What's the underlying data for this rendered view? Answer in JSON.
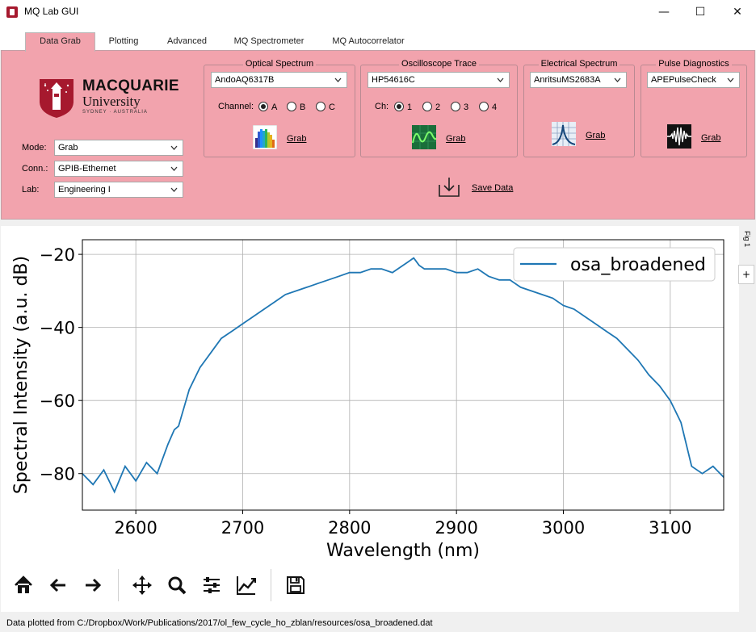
{
  "window": {
    "title": "MQ Lab GUI",
    "min": "—",
    "max": "☐",
    "close": "✕"
  },
  "tabs": [
    {
      "label": "Data Grab",
      "active": true
    },
    {
      "label": "Plotting"
    },
    {
      "label": "Advanced"
    },
    {
      "label": "MQ Spectrometer"
    },
    {
      "label": "MQ Autocorrelator"
    }
  ],
  "logo": {
    "line1": "MACQUARIE",
    "line2": "University",
    "line3": "SYDNEY · AUSTRALIA"
  },
  "settings": {
    "mode_label": "Mode:",
    "mode_value": "Grab",
    "conn_label": "Conn.:",
    "conn_value": "GPIB-Ethernet",
    "lab_label": "Lab:",
    "lab_value": "Engineering I"
  },
  "optical": {
    "title": "Optical Spectrum",
    "device": "AndoAQ6317B",
    "channel_label": "Channel:",
    "channels": [
      "A",
      "B",
      "C"
    ],
    "selected": "A",
    "grab": "Grab"
  },
  "scope": {
    "title": "Oscilloscope Trace",
    "device": "HP54616C",
    "channel_label": "Ch:",
    "channels": [
      "1",
      "2",
      "3",
      "4"
    ],
    "selected": "1",
    "grab": "Grab"
  },
  "electrical": {
    "title": "Electrical Spectrum",
    "device": "AnritsuMS2683A",
    "grab": "Grab"
  },
  "pulse": {
    "title": "Pulse Diagnostics",
    "device": "APEPulseCheck",
    "grab": "Grab"
  },
  "save": {
    "label": "Save Data"
  },
  "figure": {
    "tab_label": "Fig 1",
    "add_label": "+"
  },
  "colors": {
    "panel": "#f2a3ad",
    "line": "#1f77b4",
    "brand": "#a6192e"
  },
  "toolbar": [
    "home-icon",
    "back-icon",
    "forward-icon",
    "pan-icon",
    "zoom-icon",
    "configure-icon",
    "axes-icon",
    "save-icon"
  ],
  "status": "Data plotted from C:/Dropbox/Work/Publications/2017/ol_few_cycle_ho_zblan/resources/osa_broadened.dat",
  "chart_data": {
    "type": "line",
    "xlabel": "Wavelength (nm)",
    "ylabel": "Spectral Intensity (a.u. dB)",
    "xlim": [
      2550,
      3150
    ],
    "ylim": [
      -90,
      -16
    ],
    "xticks": [
      2600,
      2700,
      2800,
      2900,
      3000,
      3100
    ],
    "yticks": [
      -20,
      -40,
      -60,
      -80
    ],
    "grid": true,
    "legend_position": "top-right",
    "series": [
      {
        "name": "osa_broadened",
        "x": [
          2550,
          2560,
          2570,
          2580,
          2590,
          2600,
          2610,
          2620,
          2630,
          2636,
          2640,
          2645,
          2650,
          2660,
          2670,
          2680,
          2690,
          2700,
          2710,
          2720,
          2730,
          2740,
          2750,
          2760,
          2770,
          2780,
          2790,
          2800,
          2810,
          2820,
          2830,
          2840,
          2850,
          2855,
          2860,
          2865,
          2870,
          2880,
          2890,
          2900,
          2910,
          2920,
          2930,
          2940,
          2950,
          2960,
          2970,
          2980,
          2990,
          3000,
          3010,
          3020,
          3030,
          3040,
          3050,
          3060,
          3070,
          3080,
          3090,
          3100,
          3105,
          3110,
          3115,
          3120,
          3130,
          3140,
          3150
        ],
        "y": [
          -80,
          -83,
          -79,
          -85,
          -78,
          -82,
          -77,
          -80,
          -72,
          -68,
          -67,
          -62,
          -57,
          -51,
          -47,
          -43,
          -41,
          -39,
          -37,
          -35,
          -33,
          -31,
          -30,
          -29,
          -28,
          -27,
          -26,
          -25,
          -25,
          -24,
          -24,
          -25,
          -23,
          -22,
          -21,
          -23,
          -24,
          -24,
          -24,
          -25,
          -25,
          -24,
          -26,
          -27,
          -27,
          -29,
          -30,
          -31,
          -32,
          -34,
          -35,
          -37,
          -39,
          -41,
          -43,
          -46,
          -49,
          -53,
          -56,
          -60,
          -63,
          -66,
          -72,
          -78,
          -80,
          -78,
          -81
        ]
      }
    ]
  }
}
